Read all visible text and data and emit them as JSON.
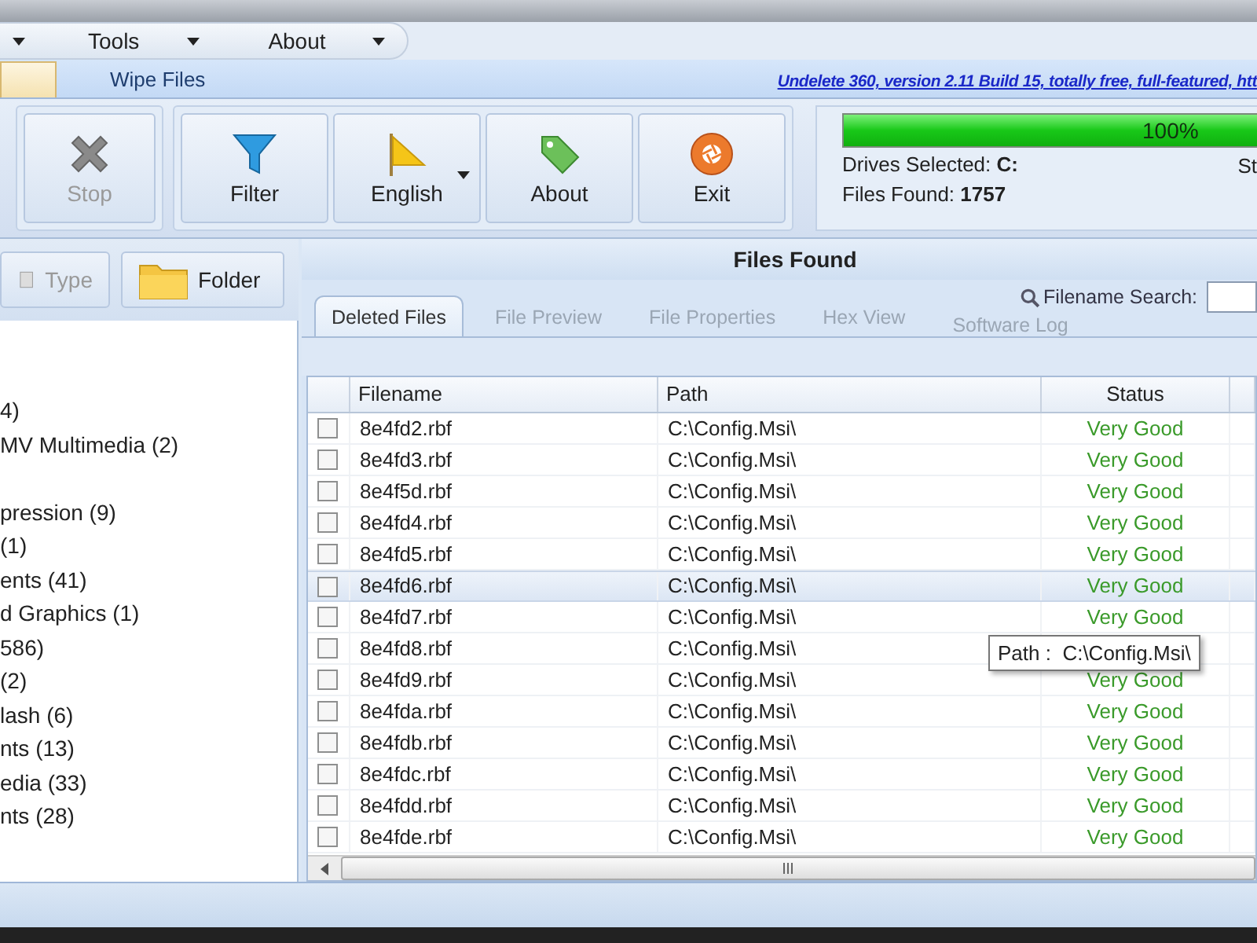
{
  "menu": [
    {
      "label": "Tools"
    },
    {
      "label": "About"
    }
  ],
  "ribbon": {
    "tabs": [
      {
        "label": "Wipe Files",
        "selected": false
      }
    ],
    "link": "Undelete 360, version 2.11 Build 15, totally free, full-featured, htt"
  },
  "toolbar_groups": [
    [
      {
        "label": "Stop",
        "kind": "stop",
        "disabled": true,
        "dropdown": false
      }
    ],
    [
      {
        "label": "Filter",
        "kind": "filter",
        "disabled": false,
        "dropdown": false
      },
      {
        "label": "English",
        "kind": "flag",
        "disabled": false,
        "dropdown": true
      },
      {
        "label": "About",
        "kind": "tag",
        "disabled": false,
        "dropdown": false
      },
      {
        "label": "Exit",
        "kind": "exit",
        "disabled": false,
        "dropdown": false
      }
    ]
  ],
  "scan_status": {
    "level": 1,
    "percent": "100%",
    "drives_label": "Drives Selected:",
    "drives_value": "C:",
    "files_label": "Files Found:",
    "files_value": "1757",
    "column_2": "St"
  },
  "view_buttons": [
    {
      "label": "Type",
      "kind": "type",
      "disabled": true
    },
    {
      "label": "Folder",
      "kind": "folder",
      "disabled": false
    }
  ],
  "tree": [
    {
      "label": "4)",
      "gap_before": false
    },
    {
      "label": "MV Multimedia (2)",
      "gap_before": false
    },
    {
      "label": "pression (9)",
      "gap_before": true
    },
    {
      "label": "(1)",
      "gap_before": false
    },
    {
      "label": "ents (41)",
      "gap_before": false
    },
    {
      "label": "d Graphics (1)",
      "gap_before": false
    },
    {
      "label": "586)",
      "gap_before": false
    },
    {
      "label": "(2)",
      "gap_before": false
    },
    {
      "label": "lash (6)",
      "gap_before": false
    },
    {
      "label": "nts (13)",
      "gap_before": false
    },
    {
      "label": "edia (33)",
      "gap_before": false
    },
    {
      "label": "nts (28)",
      "gap_before": false
    }
  ],
  "results": {
    "title": "Files Found",
    "tabs": [
      {
        "label": "Deleted Files",
        "selected": true
      },
      {
        "label": "File Preview",
        "selected": false
      },
      {
        "label": "File Properties",
        "selected": false
      },
      {
        "label": "Hex View",
        "selected": false
      },
      {
        "label": "Software Log",
        "selected": false
      }
    ],
    "search": {
      "label": "Filename Search:"
    },
    "table": {
      "columns": [
        "Filename",
        "Path",
        "Status"
      ],
      "rows": [
        {
          "filename": "8e4fd2.rbf",
          "path": "C:\\Config.Msi\\",
          "status": "Very Good",
          "checked": false,
          "highlighted": false
        },
        {
          "filename": "8e4fd3.rbf",
          "path": "C:\\Config.Msi\\",
          "status": "Very Good",
          "checked": false,
          "highlighted": false
        },
        {
          "filename": "8e4f5d.rbf",
          "path": "C:\\Config.Msi\\",
          "status": "Very Good",
          "checked": false,
          "highlighted": false
        },
        {
          "filename": "8e4fd4.rbf",
          "path": "C:\\Config.Msi\\",
          "status": "Very Good",
          "checked": false,
          "highlighted": false
        },
        {
          "filename": "8e4fd5.rbf",
          "path": "C:\\Config.Msi\\",
          "status": "Very Good",
          "checked": false,
          "highlighted": false
        },
        {
          "filename": "8e4fd6.rbf",
          "path": "C:\\Config.Msi\\",
          "status": "Very Good",
          "checked": false,
          "highlighted": true
        },
        {
          "filename": "8e4fd7.rbf",
          "path": "C:\\Config.Msi\\",
          "status": "Very Good",
          "checked": false,
          "highlighted": false
        },
        {
          "filename": "8e4fd8.rbf",
          "path": "C:\\Config.Msi\\",
          "checked": false,
          "highlighted": false
        },
        {
          "filename": "8e4fd9.rbf",
          "path": "C:\\Config.Msi\\",
          "status": "Very Good",
          "checked": false,
          "highlighted": false
        },
        {
          "filename": "8e4fda.rbf",
          "path": "C:\\Config.Msi\\",
          "status": "Very Good",
          "checked": false,
          "highlighted": false
        },
        {
          "filename": "8e4fdb.rbf",
          "path": "C:\\Config.Msi\\",
          "status": "Very Good",
          "checked": false,
          "highlighted": false
        },
        {
          "filename": "8e4fdc.rbf",
          "path": "C:\\Config.Msi\\",
          "status": "Very Good",
          "checked": false,
          "highlighted": false
        },
        {
          "filename": "8e4fdd.rbf",
          "path": "C:\\Config.Msi\\",
          "status": "Very Good",
          "checked": false,
          "highlighted": false
        },
        {
          "filename": "8e4fde.rbf",
          "path": "C:\\Config.Msi\\",
          "status": "Very Good",
          "checked": false,
          "highlighted": false
        }
      ]
    },
    "tooltip": {
      "label": "Path :",
      "value": "C:\\Config.Msi\\"
    }
  }
}
